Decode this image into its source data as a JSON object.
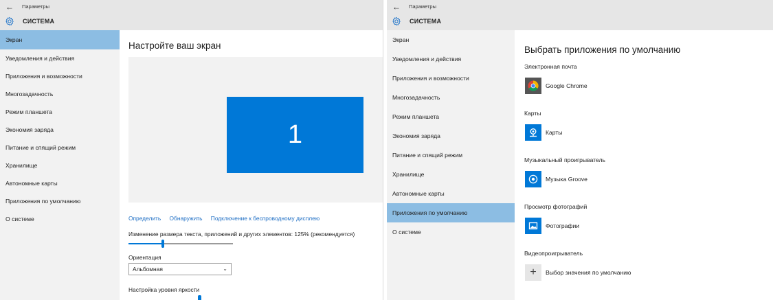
{
  "common": {
    "back_glyph": "←",
    "app_title": "Параметры",
    "section_title": "СИСТЕМА"
  },
  "left": {
    "nav": [
      {
        "label": "Экран",
        "active": true
      },
      {
        "label": "Уведомления и действия"
      },
      {
        "label": "Приложения и возможности"
      },
      {
        "label": "Многозадачность"
      },
      {
        "label": "Режим планшета"
      },
      {
        "label": "Экономия заряда"
      },
      {
        "label": "Питание и спящий режим"
      },
      {
        "label": "Хранилище"
      },
      {
        "label": "Автономные карты"
      },
      {
        "label": "Приложения по умолчанию"
      },
      {
        "label": "О системе"
      }
    ],
    "heading": "Настройте ваш экран",
    "monitor_number": "1",
    "links": {
      "identify": "Определить",
      "detect": "Обнаружить",
      "wireless": "Подключение к беспроводному дисплею"
    },
    "scale_label": "Изменение размера текста, приложений и других элементов: 125% (рекомендуется)",
    "scale_slider_position": 0.33,
    "orientation_label": "Ориентация",
    "orientation_value": "Альбомная",
    "brightness_label": "Настройка уровня яркости"
  },
  "right": {
    "nav": [
      {
        "label": "Экран"
      },
      {
        "label": "Уведомления и действия"
      },
      {
        "label": "Приложения и возможности"
      },
      {
        "label": "Многозадачность"
      },
      {
        "label": "Режим планшета"
      },
      {
        "label": "Экономия заряда"
      },
      {
        "label": "Питание и спящий режим"
      },
      {
        "label": "Хранилище"
      },
      {
        "label": "Автономные карты"
      },
      {
        "label": "Приложения по умолчанию",
        "active": true
      },
      {
        "label": "О системе"
      }
    ],
    "heading": "Выбрать приложения по умолчанию",
    "defaults": [
      {
        "category": "Электронная почта",
        "app": "Google Chrome",
        "icon": "chrome-icon"
      },
      {
        "category": "Карты",
        "app": "Карты",
        "icon": "maps-icon"
      },
      {
        "category": "Музыкальный проигрыватель",
        "app": "Музыка Groove",
        "icon": "groove-music-icon"
      },
      {
        "category": "Просмотр фотографий",
        "app": "Фотографии",
        "icon": "photos-icon"
      },
      {
        "category": "Видеопроигрыватель",
        "app": "Выбор значения по умолчанию",
        "icon": "plus-icon"
      }
    ]
  },
  "colors": {
    "accent": "#0078d7",
    "active_nav": "#8cbde3",
    "sidebar_bg": "#f2f2f2",
    "titlebar_bg": "#e6e6e6",
    "link": "#1e6ec4"
  }
}
